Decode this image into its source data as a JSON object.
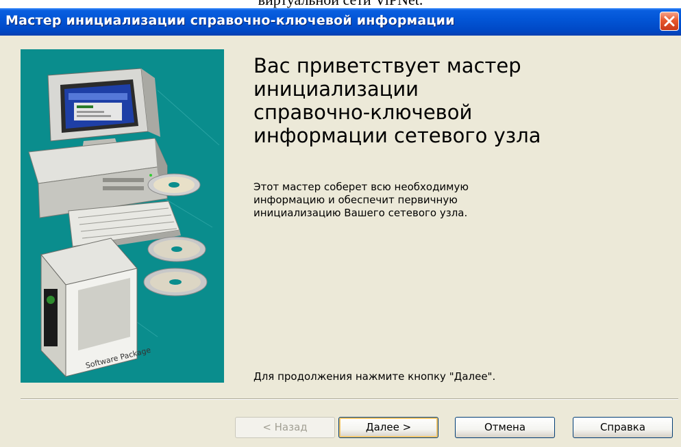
{
  "document": {
    "caption": "виртуальной сети ViPNet."
  },
  "window": {
    "title": "Мастер инициализации справочно-ключевой информации"
  },
  "content": {
    "heading_lines": [
      "Вас приветствует мастер",
      "инициализации",
      "справочно-ключевой",
      "информации сетевого узла"
    ],
    "body_lines": [
      "Этот мастер соберет всю необходимую",
      "информацию и обеспечит первичную",
      "инициализацию Вашего сетевого узла."
    ],
    "footer": "Для продолжения нажмите кнопку \"Далее\".",
    "illustration": {
      "box_text": "Software Package"
    }
  },
  "buttons": {
    "back": "< Назад",
    "next": "Далее >",
    "cancel": "Отмена",
    "help": "Справка"
  },
  "colors": {
    "titlebar": "#0255d6",
    "panel": "#0a8d8d",
    "window_bg": "#ece9d8",
    "close": "#e8582d"
  },
  "icons": {
    "close": "close-icon"
  }
}
